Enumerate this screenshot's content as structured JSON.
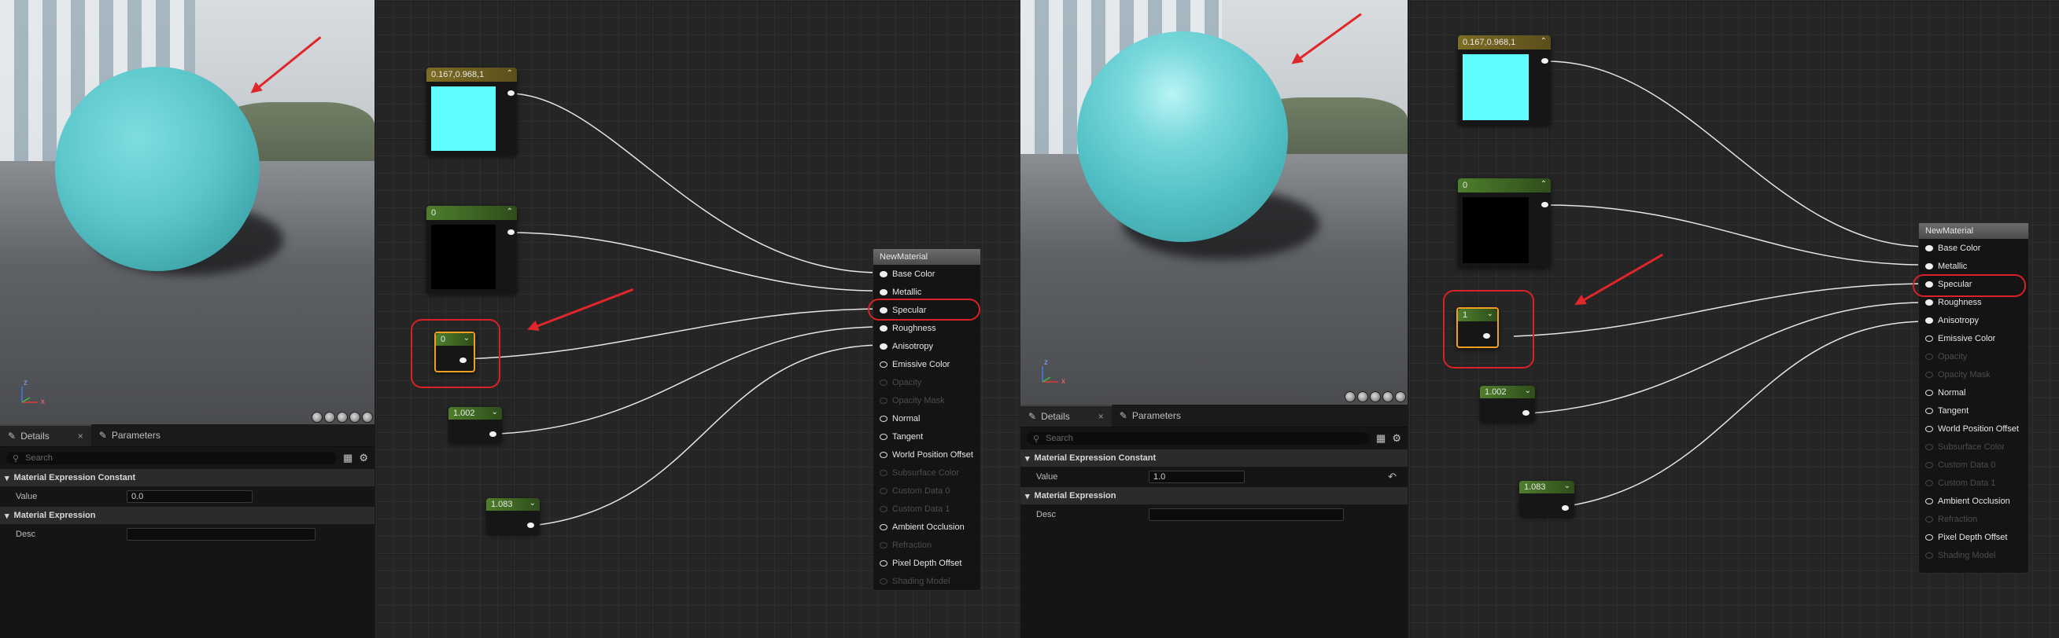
{
  "panels": [
    {
      "id": "left",
      "details": {
        "tab_details": "Details",
        "tab_close": "×",
        "tab_parameters": "Parameters",
        "search_placeholder": "Search",
        "category1": "Material Expression Constant",
        "value_label": "Value",
        "value": "0.0",
        "category2": "Material Expression",
        "desc_label": "Desc"
      },
      "nodes": {
        "color_label": "0.167,0.968,1",
        "metallic_label": "0",
        "specular_label": "0",
        "roughness_label": "1.002",
        "anisotropy_label": "1.083"
      }
    },
    {
      "id": "right",
      "details": {
        "tab_details": "Details",
        "tab_close": "×",
        "tab_parameters": "Parameters",
        "search_placeholder": "Search",
        "category1": "Material Expression Constant",
        "value_label": "Value",
        "value": "1.0",
        "reset_icon": "↶",
        "category2": "Material Expression",
        "desc_label": "Desc"
      },
      "nodes": {
        "color_label": "0.167,0.968,1",
        "metallic_label": "0",
        "specular_label": "1",
        "roughness_label": "1.002",
        "anisotropy_label": "1.083"
      }
    }
  ],
  "material_node": {
    "title": "NewMaterial",
    "pins": [
      {
        "label": "Base Color",
        "enabled": true
      },
      {
        "label": "Metallic",
        "enabled": true
      },
      {
        "label": "Specular",
        "enabled": true
      },
      {
        "label": "Roughness",
        "enabled": true
      },
      {
        "label": "Anisotropy",
        "enabled": true
      },
      {
        "label": "Emissive Color",
        "enabled": true
      },
      {
        "label": "Opacity",
        "enabled": false
      },
      {
        "label": "Opacity Mask",
        "enabled": false
      },
      {
        "label": "Normal",
        "enabled": true
      },
      {
        "label": "Tangent",
        "enabled": true
      },
      {
        "label": "World Position Offset",
        "enabled": true
      },
      {
        "label": "Subsurface Color",
        "enabled": false
      },
      {
        "label": "Custom Data 0",
        "enabled": false
      },
      {
        "label": "Custom Data 1",
        "enabled": false
      },
      {
        "label": "Ambient Occlusion",
        "enabled": true
      },
      {
        "label": "Refraction",
        "enabled": false
      },
      {
        "label": "Pixel Depth Offset",
        "enabled": true
      },
      {
        "label": "Shading Model",
        "enabled": false
      }
    ]
  },
  "viewport": {
    "axis_x": "x",
    "axis_z": "z"
  },
  "colors": {
    "base_color_swatch": "#5ffdfd",
    "metallic_swatch": "#000000",
    "vector_node_header": "#7a6a25",
    "scalar_node_header": "#4a7a2a",
    "highlight_red": "#d82226",
    "selection_orange": "#f0a020"
  }
}
